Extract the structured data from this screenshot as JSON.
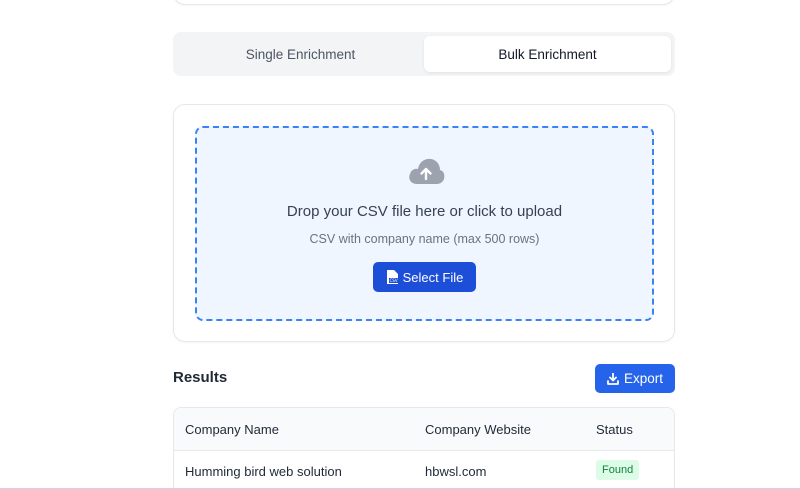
{
  "tabs": [
    {
      "label": "Single Enrichment",
      "active": false
    },
    {
      "label": "Bulk Enrichment",
      "active": true
    }
  ],
  "upload": {
    "icon": "cloud-upload-icon",
    "title": "Drop your CSV file here or click to upload",
    "subtitle": "CSV with company name (max 500 rows)",
    "select_label": "Select File",
    "select_icon": "csv-file-icon"
  },
  "results": {
    "title": "Results",
    "export_label": "Export",
    "export_icon": "download-icon",
    "columns": [
      "Company Name",
      "Company Website",
      "Status"
    ],
    "rows": [
      {
        "company": "Humming bird web solution",
        "website": "hbwsl.com",
        "status": "Found"
      }
    ]
  },
  "colors": {
    "primary": "#2563eb",
    "dropzone_border": "#3b82f6",
    "found_bg": "#dcfce7",
    "found_text": "#15803d"
  }
}
